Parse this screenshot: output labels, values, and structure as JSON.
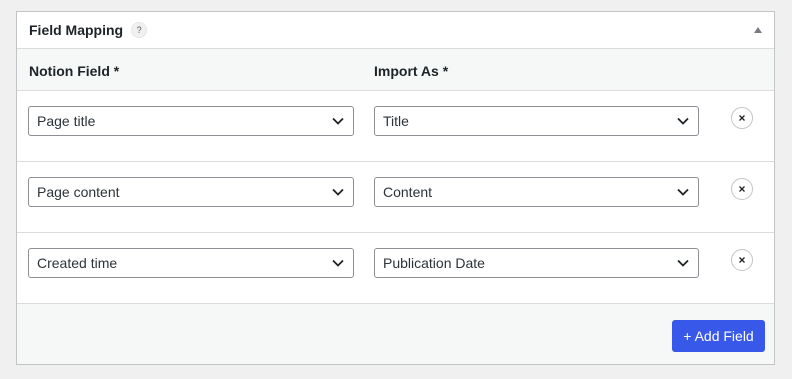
{
  "panel": {
    "title": "Field Mapping",
    "help": "?"
  },
  "columns": {
    "notion_field": "Notion Field",
    "import_as": "Import As",
    "required_mark": "*"
  },
  "rows": [
    {
      "notion": "Page title",
      "import": "Title"
    },
    {
      "notion": "Page content",
      "import": "Content"
    },
    {
      "notion": "Created time",
      "import": "Publication Date"
    }
  ],
  "footer": {
    "add_field": "+ Add Field"
  },
  "colors": {
    "accent": "#3858e9",
    "required": "#d63638"
  },
  "icons": {
    "collapse": "triangle-up-icon",
    "select": "chevron-down-icon",
    "remove": "close-icon"
  }
}
